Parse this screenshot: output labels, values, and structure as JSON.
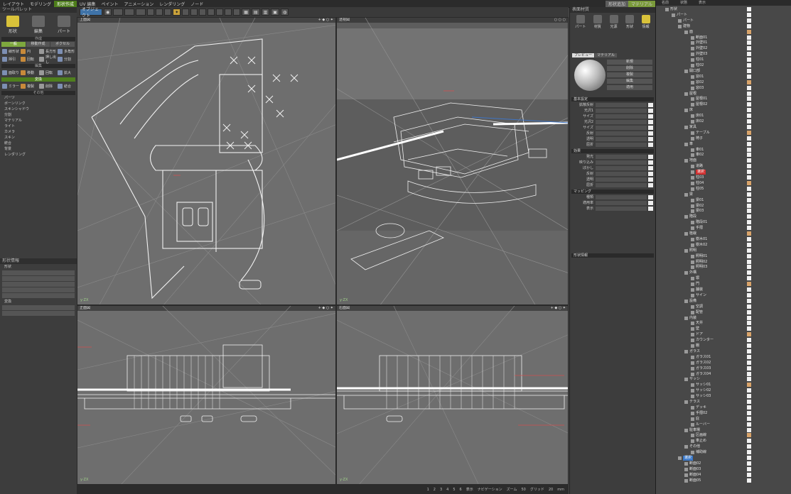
{
  "menubar": {
    "items": [
      "レイアウト",
      "モデリング",
      "形状作成",
      "UV 編集",
      "ペイント",
      "アニメーション",
      "レンダリング",
      "ノード"
    ],
    "active_index": 2,
    "extras": [
      "形状追加",
      "マテリアル"
    ]
  },
  "toolbar": {
    "mode_btn": "オブジェクト"
  },
  "left_panel": {
    "title": "ツールパレット",
    "modes": [
      {
        "label": "形状"
      },
      {
        "label": "編集"
      },
      {
        "label": "パート"
      }
    ],
    "section_create": "作成",
    "tabs": [
      "一般",
      "移動作成",
      "ボクセル"
    ],
    "section_modify": "編集",
    "section_transform": "変換",
    "section_misc": "その他",
    "tools": [
      "線形状",
      "円",
      "長方形",
      "多角形",
      "掃引",
      "回転",
      "押し出し",
      "分割",
      "面取り",
      "移動",
      "回転",
      "拡大",
      "ミラー",
      "複製",
      "削除",
      "結合"
    ],
    "list_items": [
      "パーツ",
      "ボーンリンク",
      "スキンシャドウ",
      "分割",
      "マテリアル",
      "ライト",
      "カメラ",
      "スキン",
      "統合",
      "背景",
      "レンダリング"
    ],
    "attr_title": "形状情報",
    "attr_sub": "形状",
    "attr_rows": [
      "",
      "",
      "",
      "",
      ""
    ],
    "attr_sub2": "変換"
  },
  "viewports": [
    {
      "title": "上面図",
      "ctrl": "+ ◆ ○ ✦"
    },
    {
      "title": "透視図",
      "ctrl": "○ ○ ○"
    },
    {
      "title": "正面図",
      "ctrl": "+ ◆ ○ ✦"
    },
    {
      "title": "右面図",
      "ctrl": "+ ◆ ○ ✦"
    }
  ],
  "axis_label": "y·ZX",
  "bottombar": {
    "items": [
      "1",
      "2",
      "3",
      "4",
      "5",
      "6",
      "表示",
      "ナビゲーション",
      "ズーム",
      "50",
      "グリッド",
      "20",
      "mm"
    ]
  },
  "right_panel": {
    "title": "表面材質",
    "icons": [
      {
        "label": "パート"
      },
      {
        "label": "材質"
      },
      {
        "label": "光源"
      },
      {
        "label": "形状"
      },
      {
        "label": "情報"
      }
    ],
    "mat_tabs": [
      "プレビュー",
      "マテリアル"
    ],
    "mat_buttons": [
      "新規",
      "削除",
      "複製",
      "編集",
      "適用"
    ],
    "section_base": "基本設定",
    "props_base": [
      "拡散反射",
      "光沢1",
      "サイズ",
      "光沢2",
      "サイズ",
      "反射",
      "透明",
      "屈折"
    ],
    "section_effect": "効果",
    "props_effect": [
      "発光",
      "映り込み",
      "ぼかし",
      "反射",
      "透明",
      "屈折"
    ],
    "section_map": "マッピング",
    "props_map": [
      "種類",
      "適用率",
      "表示"
    ],
    "section_shape": "形状情報"
  },
  "outliner": {
    "headers": [
      "名前",
      "状態",
      "表示"
    ],
    "rows": [
      {
        "label": "形状",
        "depth": 0
      },
      {
        "label": "パート",
        "depth": 1
      },
      {
        "label": "パート",
        "depth": 2
      },
      {
        "label": "建物",
        "depth": 2
      },
      {
        "label": "面",
        "depth": 3
      },
      {
        "label": "断面01",
        "depth": 4
      },
      {
        "label": "外壁01",
        "depth": 4
      },
      {
        "label": "外壁02",
        "depth": 4
      },
      {
        "label": "外壁03",
        "depth": 4
      },
      {
        "label": "柱01",
        "depth": 4
      },
      {
        "label": "柱02",
        "depth": 4
      },
      {
        "label": "開口部",
        "depth": 3
      },
      {
        "label": "窓01",
        "depth": 4
      },
      {
        "label": "窓02",
        "depth": 4
      },
      {
        "label": "窓03",
        "depth": 4
      },
      {
        "label": "屋根",
        "depth": 3
      },
      {
        "label": "屋根01",
        "depth": 4
      },
      {
        "label": "屋根02",
        "depth": 4
      },
      {
        "label": "床",
        "depth": 3
      },
      {
        "label": "床01",
        "depth": 4
      },
      {
        "label": "床02",
        "depth": 4
      },
      {
        "label": "家具",
        "depth": 3
      },
      {
        "label": "テーブル",
        "depth": 4
      },
      {
        "label": "椅子",
        "depth": 4
      },
      {
        "label": "車",
        "depth": 3
      },
      {
        "label": "車01",
        "depth": 4
      },
      {
        "label": "車02",
        "depth": 4
      },
      {
        "label": "地面",
        "depth": 3
      },
      {
        "label": "道路",
        "depth": 4
      },
      {
        "label": "選択",
        "depth": 4,
        "state": "red"
      },
      {
        "label": "柱03",
        "depth": 4
      },
      {
        "label": "柱04",
        "depth": 4
      },
      {
        "label": "柱05",
        "depth": 4
      },
      {
        "label": "梁",
        "depth": 3
      },
      {
        "label": "梁01",
        "depth": 4
      },
      {
        "label": "梁02",
        "depth": 4
      },
      {
        "label": "梁03",
        "depth": 4
      },
      {
        "label": "階段",
        "depth": 3
      },
      {
        "label": "階段01",
        "depth": 4
      },
      {
        "label": "手摺",
        "depth": 4
      },
      {
        "label": "植栽",
        "depth": 3
      },
      {
        "label": "樹木01",
        "depth": 4
      },
      {
        "label": "樹木02",
        "depth": 4
      },
      {
        "label": "照明",
        "depth": 3
      },
      {
        "label": "照明01",
        "depth": 4
      },
      {
        "label": "照明02",
        "depth": 4
      },
      {
        "label": "照明03",
        "depth": 4
      },
      {
        "label": "外構",
        "depth": 3
      },
      {
        "label": "塀",
        "depth": 4
      },
      {
        "label": "門",
        "depth": 4
      },
      {
        "label": "舗装",
        "depth": 4
      },
      {
        "label": "サイン",
        "depth": 4
      },
      {
        "label": "設備",
        "depth": 3
      },
      {
        "label": "空調",
        "depth": 4
      },
      {
        "label": "配管",
        "depth": 4
      },
      {
        "label": "内装",
        "depth": 3
      },
      {
        "label": "天井",
        "depth": 4
      },
      {
        "label": "壁",
        "depth": 4
      },
      {
        "label": "ドア",
        "depth": 4
      },
      {
        "label": "カウンター",
        "depth": 4
      },
      {
        "label": "棚",
        "depth": 4
      },
      {
        "label": "ガラス",
        "depth": 3
      },
      {
        "label": "ガラス01",
        "depth": 4
      },
      {
        "label": "ガラス02",
        "depth": 4
      },
      {
        "label": "ガラス03",
        "depth": 4
      },
      {
        "label": "ガラス04",
        "depth": 4
      },
      {
        "label": "サッシ",
        "depth": 3
      },
      {
        "label": "サッシ01",
        "depth": 4
      },
      {
        "label": "サッシ02",
        "depth": 4
      },
      {
        "label": "サッシ03",
        "depth": 4
      },
      {
        "label": "テラス",
        "depth": 3
      },
      {
        "label": "デッキ",
        "depth": 4
      },
      {
        "label": "手摺02",
        "depth": 4
      },
      {
        "label": "庇",
        "depth": 4
      },
      {
        "label": "ルーバー",
        "depth": 4
      },
      {
        "label": "駐車場",
        "depth": 3
      },
      {
        "label": "区画線",
        "depth": 4
      },
      {
        "label": "車止め",
        "depth": 4
      },
      {
        "label": "その他",
        "depth": 3
      },
      {
        "label": "補助線",
        "depth": 4
      },
      {
        "label": "選択",
        "depth": 2,
        "state": "blue"
      },
      {
        "label": "断面02",
        "depth": 3
      },
      {
        "label": "断面03",
        "depth": 3
      },
      {
        "label": "断面04",
        "depth": 3
      },
      {
        "label": "断面05",
        "depth": 3
      }
    ]
  },
  "colors": {
    "accent_green": "#4f7f1e",
    "selection_yellow": "#d9c23a",
    "highlight_red": "#d23030",
    "highlight_blue": "#3a78c8"
  }
}
